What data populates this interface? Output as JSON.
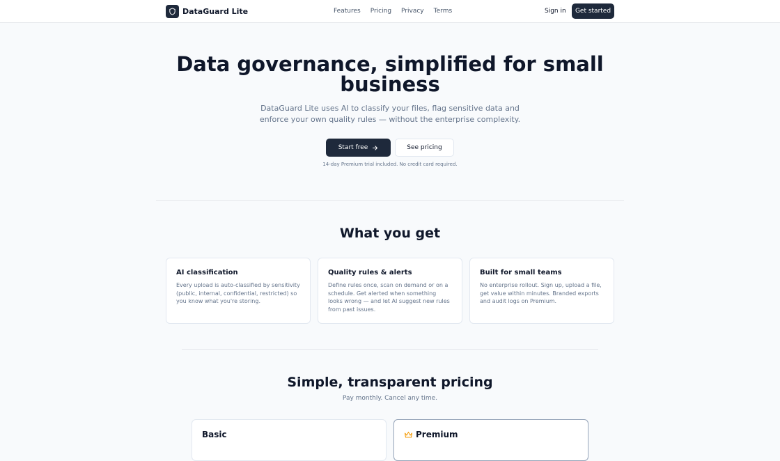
{
  "header": {
    "brand": "DataGuard Lite",
    "nav": [
      "Features",
      "Pricing",
      "Privacy",
      "Terms"
    ],
    "signin": "Sign in",
    "cta": "Get started"
  },
  "hero": {
    "title": "Data governance, simplified for small business",
    "subtitle": "DataGuard Lite uses AI to classify your files, flag sensitive data and enforce your own quality rules — without the enterprise complexity.",
    "primary_cta": "Start free",
    "secondary_cta": "See pricing",
    "note": "14-day Premium trial included. No credit card required."
  },
  "features": {
    "title": "What you get",
    "cards": [
      {
        "title": "AI classification",
        "body": "Every upload is auto-classified by sensitivity (public, internal, confidential, restricted) so you know what you're storing."
      },
      {
        "title": "Quality rules & alerts",
        "body": "Define rules once, scan on demand or on a schedule. Get alerted when something looks wrong — and let AI suggest new rules from past issues."
      },
      {
        "title": "Built for small teams",
        "body": "No enterprise rollout. Sign up, upload a file, get value within minutes. Branded exports and audit logs on Premium."
      }
    ]
  },
  "pricing": {
    "title": "Simple, transparent pricing",
    "subtitle": "Pay monthly. Cancel any time.",
    "plans": [
      {
        "name": "Basic"
      },
      {
        "name": "Premium",
        "icon": "crown-icon"
      }
    ]
  },
  "colors": {
    "primary": "#1e293b",
    "crown": "#f59e0b"
  }
}
